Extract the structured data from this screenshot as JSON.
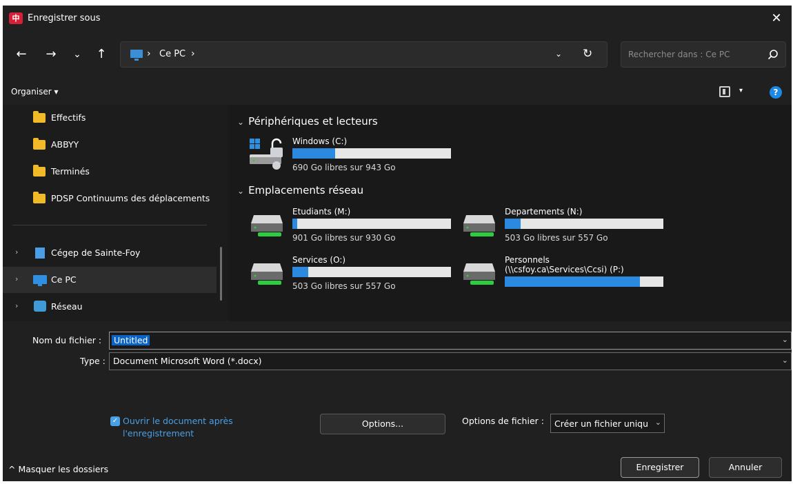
{
  "window": {
    "title": "Enregistrer sous",
    "app_icon_text": "中",
    "close_symbol": "✕"
  },
  "nav": {
    "back_symbol": "←",
    "forward_symbol": "→",
    "recent_symbol": "⌄",
    "up_symbol": "↑",
    "address_sep1": "›",
    "address_location": "Ce PC",
    "address_sep2": "›",
    "address_dropdown_symbol": "⌄",
    "refresh_symbol": "↻",
    "search_placeholder": "Rechercher dans : Ce PC"
  },
  "toolbar": {
    "organise_label": "Organiser ▾",
    "view_caret": "▾",
    "help_symbol": "?"
  },
  "sidebar": {
    "folders": [
      {
        "label": "Effectifs"
      },
      {
        "label": "ABBYY"
      },
      {
        "label": "Terminés"
      },
      {
        "label": "PDSP Continuums des déplacements"
      }
    ],
    "locations": [
      {
        "label": "Cégep de Sainte-Foy",
        "chevron": "›",
        "icon": "building-icon"
      },
      {
        "label": "Ce PC",
        "chevron": "›",
        "icon": "computer-icon",
        "selected": true
      },
      {
        "label": "Réseau",
        "chevron": "›",
        "icon": "network-icon"
      }
    ]
  },
  "main": {
    "devices_heading": "Périphériques et lecteurs",
    "network_heading": "Emplacements réseau",
    "heading_chevron": "⌄",
    "devices": [
      {
        "name": "Windows (C:)",
        "free": "690 Go libres sur 943 Go",
        "used_fraction": 0.27
      }
    ],
    "network": [
      {
        "name": "Etudiants (M:)",
        "free": "901 Go libres sur 930 Go",
        "used_fraction": 0.03
      },
      {
        "name": "Departements (N:)",
        "free": "503 Go libres sur 557 Go",
        "used_fraction": 0.1
      },
      {
        "name": "Services (O:)",
        "free": "503 Go libres sur 557 Go",
        "used_fraction": 0.1
      },
      {
        "name": "Personnels",
        "name_line2": "(\\\\csfoy.ca\\Services\\Ccsi) (P:)",
        "free": "",
        "used_fraction": 0.85
      }
    ]
  },
  "form": {
    "filename_label": "Nom du fichier :",
    "filename_value": "Untitled",
    "type_label": "Type :",
    "type_value": "Document Microsoft Word (*.docx)",
    "field_chevron": "⌄",
    "open_after_checked": true,
    "open_after_label": "Ouvrir le document après l'enregistrement",
    "options_button": "Options...",
    "file_options_label": "Options de fichier :",
    "file_options_value": "Créer un fichier uniqu",
    "hide_folders_label": "^  Masquer les dossiers",
    "save_button": "Enregistrer",
    "cancel_button": "Annuler"
  },
  "colors": {
    "accent": "#2b8ae0",
    "folder": "#f2b929",
    "background": "#202020"
  }
}
